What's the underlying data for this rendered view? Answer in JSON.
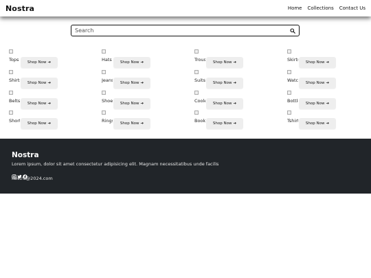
{
  "navbar": {
    "brand": "Nostra",
    "links": [
      "Home",
      "Collections",
      "Contact Us"
    ]
  },
  "search": {
    "placeholder": "Search",
    "icon": "search-icon"
  },
  "products": [
    {
      "name": "Tops",
      "button": "Shop Now"
    },
    {
      "name": "Hats",
      "button": "Shop Now"
    },
    {
      "name": "Trousers",
      "button": "Shop Now"
    },
    {
      "name": "Skirts",
      "button": "Shop Now"
    },
    {
      "name": "Shirts",
      "button": "Shop Now"
    },
    {
      "name": "Jeans",
      "button": "Shop Now"
    },
    {
      "name": "Suits",
      "button": "Shop Now"
    },
    {
      "name": "Watches",
      "button": "Shop Now"
    },
    {
      "name": "Belts",
      "button": "Shop Now"
    },
    {
      "name": "Shoes",
      "button": "Shop Now"
    },
    {
      "name": "Coolers",
      "button": "Shop Now"
    },
    {
      "name": "Bottles",
      "button": "Shop Now"
    },
    {
      "name": "Shorts",
      "button": "Shop Now"
    },
    {
      "name": "Rings",
      "button": "Shop Now"
    },
    {
      "name": "Books",
      "button": "Shop Now"
    },
    {
      "name": "Tshirts",
      "button": "Shop Now"
    }
  ],
  "footer": {
    "title": "Nostra",
    "description": "Lorem ipsum, dolor sit amet consectetur adipisicing elit. Magnam necessitatibus unde facilis",
    "social_icons": [
      "instagram-icon",
      "twitter-icon",
      "facebook-icon"
    ],
    "email": "nostra@2024.com"
  },
  "colors": {
    "footer_bg": "#212529",
    "button_bg": "#eeeeee"
  }
}
